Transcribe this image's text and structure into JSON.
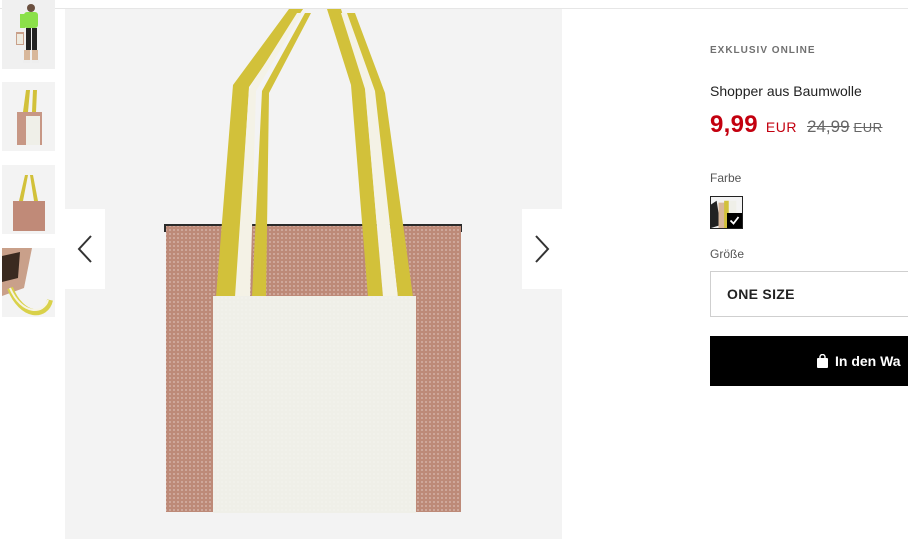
{
  "gallery": {
    "thumbnails": [
      {
        "label": "model-full-body"
      },
      {
        "label": "bag-side-view"
      },
      {
        "label": "bag-front-view"
      },
      {
        "label": "bag-detail-view"
      }
    ],
    "prev_icon": "chevron-left-icon",
    "next_icon": "chevron-right-icon"
  },
  "product": {
    "badge": "EXKLUSIV ONLINE",
    "title": "Shopper aus Baumwolle",
    "price": "9,99",
    "currency": "EUR",
    "old_price": "24,99",
    "old_currency": "EUR"
  },
  "options": {
    "color_label": "Farbe",
    "size_label": "Größe",
    "size_value": "ONE SIZE"
  },
  "cart": {
    "label": "In den Wa",
    "icon": "shopping-bag-icon"
  },
  "colors": {
    "price_red": "#c3000f",
    "button_black": "#000000",
    "bag_pink": "#bd8a78",
    "bag_cream": "#efefe8",
    "strap_yellow": "#d2c13a"
  }
}
